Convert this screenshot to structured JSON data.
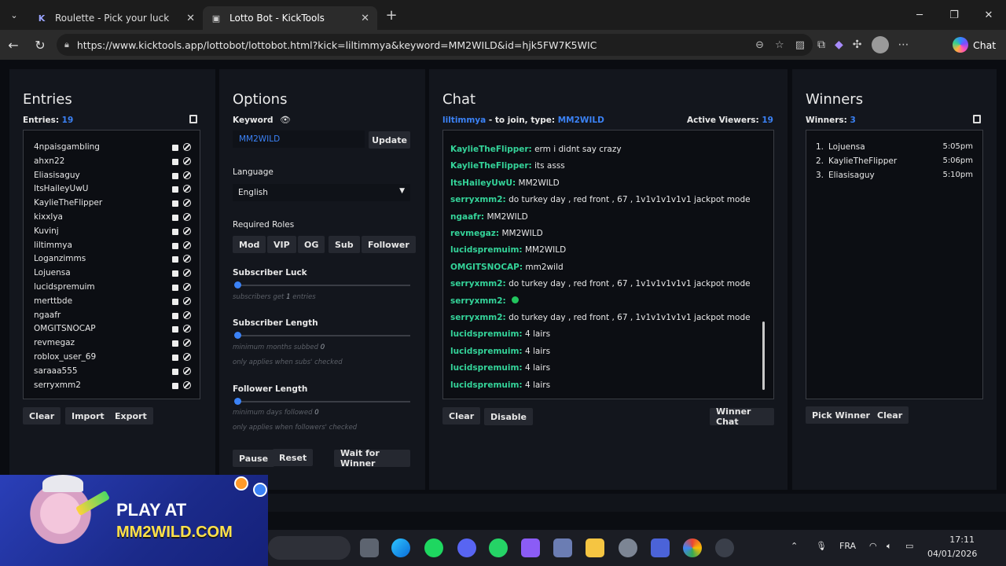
{
  "browser": {
    "tabs": [
      {
        "title": "Roulette - Pick your luck",
        "favicon": "K"
      },
      {
        "title": "Lotto Bot - KickTools",
        "favicon": "▣"
      }
    ],
    "url": "https://www.kicktools.app/lottobot/lottobot.html?kick=liltimmya&keyword=MM2WILD&id=hjk5FW7K5WIC",
    "chat_label": "Chat"
  },
  "entries": {
    "title": "Entries",
    "count_label": "Entries:",
    "count": "19",
    "names": [
      "4npaisgambling",
      "ahxn22",
      "Eliasisaguy",
      "ItsHaileyUwU",
      "KaylieTheFlipper",
      "kixxlya",
      "Kuvinj",
      "liltimmya",
      "Loganzimms",
      "Lojuensa",
      "lucidspremuim",
      "merttbde",
      "ngaafr",
      "OMGITSNOCAP",
      "revmegaz",
      "roblox_user_69",
      "saraaa555",
      "serryxmm2"
    ],
    "buttons": [
      "Clear",
      "Import",
      "Export"
    ]
  },
  "options": {
    "title": "Options",
    "keyword_label": "Keyword",
    "keyword_value": "MM2WILD",
    "update_label": "Update",
    "language_label": "Language",
    "language_value": "English",
    "roles_label": "Required Roles",
    "roles": [
      "Mod",
      "VIP",
      "OG",
      "Sub",
      "Follower"
    ],
    "sub_luck_label": "Subscriber Luck",
    "sub_luck_hint_prefix": "subscribers get",
    "sub_luck_value": "1",
    "sub_luck_hint_suffix": "entries",
    "sub_length_label": "Subscriber Length",
    "sub_length_hint_prefix": "minimum months subbed",
    "sub_length_value": "0",
    "sub_length_note": "only applies when subs' checked",
    "follower_length_label": "Follower Length",
    "follower_length_hint_prefix": "minimum days followed",
    "follower_length_value": "0",
    "follower_length_note": "only applies when followers' checked",
    "pause_label": "Pause",
    "reset_label": "Reset",
    "wait_label": "Wait for Winner"
  },
  "chat": {
    "title": "Chat",
    "host": "liltimmya",
    "join_text": "- to join, type:",
    "keyword": "MM2WILD",
    "viewers_label": "Active Viewers:",
    "viewers": "19",
    "messages": [
      {
        "user": "KaylieTheFlipper:",
        "text": "erm i didnt say crazy"
      },
      {
        "user": "KaylieTheFlipper:",
        "text": "its asss"
      },
      {
        "user": "ItsHaileyUwU:",
        "text": "MM2WILD"
      },
      {
        "user": "serryxmm2:",
        "text": "do turkey day , red front , 67 , 1v1v1v1v1v1 jackpot mode"
      },
      {
        "user": "ngaafr:",
        "text": "MM2WILD"
      },
      {
        "user": "revmegaz:",
        "text": "MM2WILD"
      },
      {
        "user": "lucidspremuim:",
        "text": "MM2WILD"
      },
      {
        "user": "OMGITSNOCAP:",
        "text": "mm2wild"
      },
      {
        "user": "serryxmm2:",
        "text": "do turkey day , red front , 67 , 1v1v1v1v1v1 jackpot mode"
      },
      {
        "user": "serryxmm2:",
        "text": ""
      },
      {
        "user": "serryxmm2:",
        "text": "do turkey day , red front , 67 , 1v1v1v1v1v1 jackpot mode"
      },
      {
        "user": "lucidspremuim:",
        "text": "4 lairs"
      },
      {
        "user": "lucidspremuim:",
        "text": "4 lairs"
      },
      {
        "user": "lucidspremuim:",
        "text": "4 lairs"
      },
      {
        "user": "lucidspremuim:",
        "text": "4 lairs"
      }
    ],
    "clear_label": "Clear",
    "disable_label": "Disable",
    "winner_chat_label": "Winner Chat"
  },
  "winners": {
    "title": "Winners",
    "count_label": "Winners:",
    "count": "3",
    "list": [
      {
        "rank": "1.",
        "name": "Lojuensa",
        "time": "5:05pm"
      },
      {
        "rank": "2.",
        "name": "KaylieTheFlipper",
        "time": "5:06pm"
      },
      {
        "rank": "3.",
        "name": "Eliasisaguy",
        "time": "5:10pm"
      }
    ],
    "pick_label": "Pick Winner",
    "clear_label": "Clear"
  },
  "ad": {
    "line1": "PLAY AT",
    "line2": "MM2WILD.COM"
  },
  "taskbar": {
    "lang": "FRA",
    "time": "17:11",
    "date": "04/01/2026"
  }
}
